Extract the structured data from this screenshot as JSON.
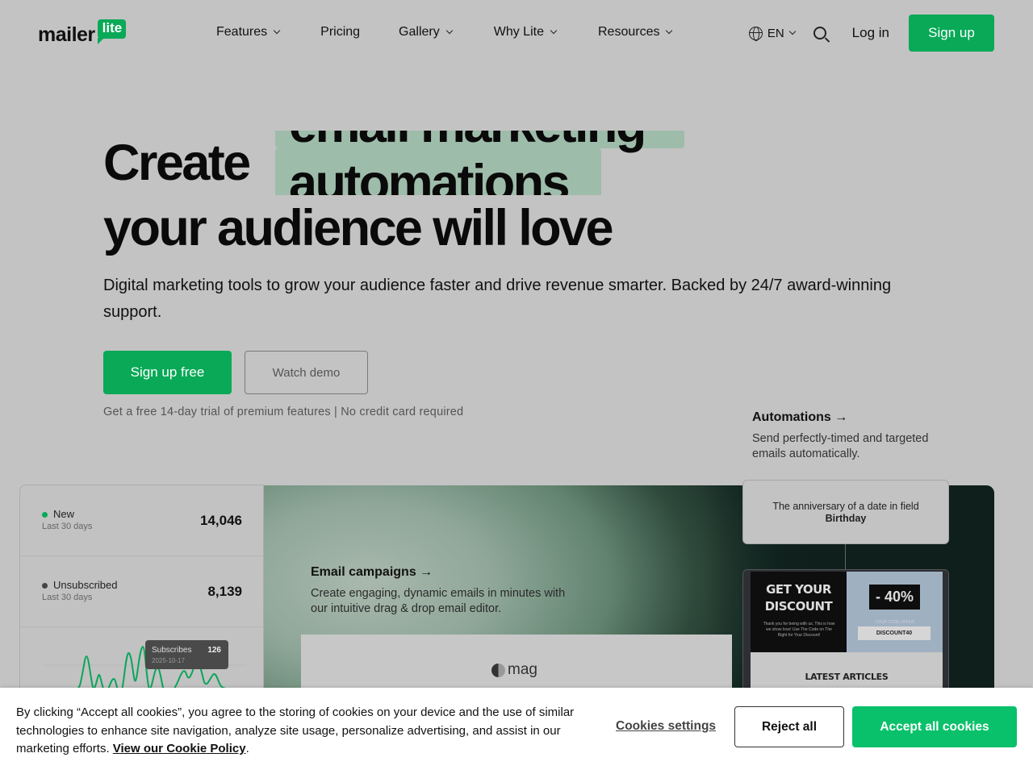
{
  "nav": {
    "logo_word": "mailer",
    "logo_badge": "lite",
    "menu": [
      {
        "label": "Features",
        "dropdown": true
      },
      {
        "label": "Pricing",
        "dropdown": false
      },
      {
        "label": "Gallery",
        "dropdown": true
      },
      {
        "label": "Why Lite",
        "dropdown": true
      },
      {
        "label": "Resources",
        "dropdown": true
      }
    ],
    "language": "EN",
    "login": "Log in",
    "signup": "Sign up"
  },
  "hero": {
    "headline_start": "Create",
    "rotating_word_prev": "email marketing",
    "rotating_word": "automations",
    "headline_end": "your audience will love",
    "subtitle": "Digital marketing tools to grow your audience faster and drive revenue smarter. Backed by 24/7 award-winning support.",
    "cta_primary": "Sign up free",
    "cta_secondary": "Watch demo",
    "trial_note": "Get a free 14-day trial of premium features | No credit card required"
  },
  "stats": {
    "rows": [
      {
        "label": "New",
        "sub": "Last 30 days",
        "value": "14,046",
        "dot_color": "#09a957"
      },
      {
        "label": "Unsubscribed",
        "sub": "Last 30 days",
        "value": "8,139",
        "dot_color": "#444444"
      }
    ],
    "tooltip": {
      "label": "Subscribes",
      "value": "126",
      "date": "2025-10-17"
    }
  },
  "email_campaigns": {
    "title": "Email campaigns →",
    "description": "Create engaging, dynamic emails in minutes with our intuitive drag & drop email editor.",
    "preview_logo": "mag"
  },
  "automations": {
    "title": "Automations →",
    "description": "Send perfectly-timed and targeted emails automatically.",
    "trigger_text": "The anniversary of a date in field",
    "trigger_field": "Birthday",
    "email_preview": {
      "headline": "GET YOUR DISCOUNT",
      "fine_print": "Thank you for being with us. This is how we show love! Use The Code on The Right for Your Discount!",
      "percent": "- 40%",
      "code_label": "YOUR CODE OFFER",
      "code": "DISCOUNT40",
      "section": "LATEST ARTICLES"
    }
  },
  "cookie": {
    "text": "By clicking “Accept all cookies”, you agree to the storing of cookies on your device and the use of similar technologies to enhance site navigation, analyze site usage, personalize advertising, and assist in our marketing efforts.",
    "link": "View our Cookie Policy",
    "settings": "Cookies settings",
    "reject": "Reject all",
    "accept": "Accept all cookies"
  },
  "colors": {
    "brand_green": "#09a957",
    "accept_green": "#09c16a",
    "highlight": "#9ebcaa"
  }
}
